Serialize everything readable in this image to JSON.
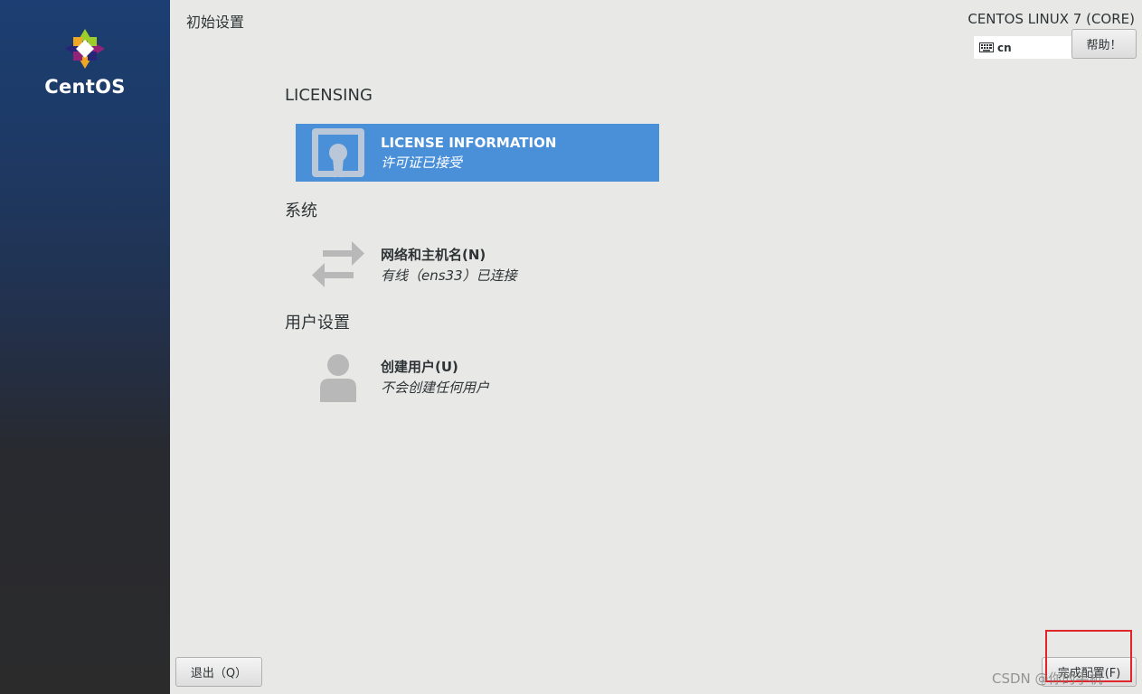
{
  "sidebar": {
    "logo_text": "CentOS"
  },
  "header": {
    "page_title": "初始设置",
    "product": "CENTOS LINUX 7 (CORE)",
    "keyboard_layout": "cn",
    "help_label": "帮助！"
  },
  "sections": [
    {
      "label": "LICENSING",
      "spokes": [
        {
          "title": "LICENSE INFORMATION",
          "status": "许可证已接受",
          "icon": "license-icon",
          "selected": true
        }
      ]
    },
    {
      "label": "系统",
      "spokes": [
        {
          "title": "网络和主机名(N)",
          "status": "有线（ens33）已连接",
          "icon": "network-icon",
          "selected": false
        }
      ]
    },
    {
      "label": "用户设置",
      "spokes": [
        {
          "title": "创建用户(U)",
          "status": "不会创建任何用户",
          "icon": "user-icon",
          "selected": false
        }
      ]
    }
  ],
  "footer": {
    "quit_label": "退出（Q）",
    "finish_label": "完成配置(F)",
    "watermark": "CSDN @你的手机"
  },
  "colors": {
    "accent": "#4a90d9",
    "highlight": "#e0262a",
    "background": "#e8e8e7",
    "sidebar_top": "#1c3e72"
  }
}
